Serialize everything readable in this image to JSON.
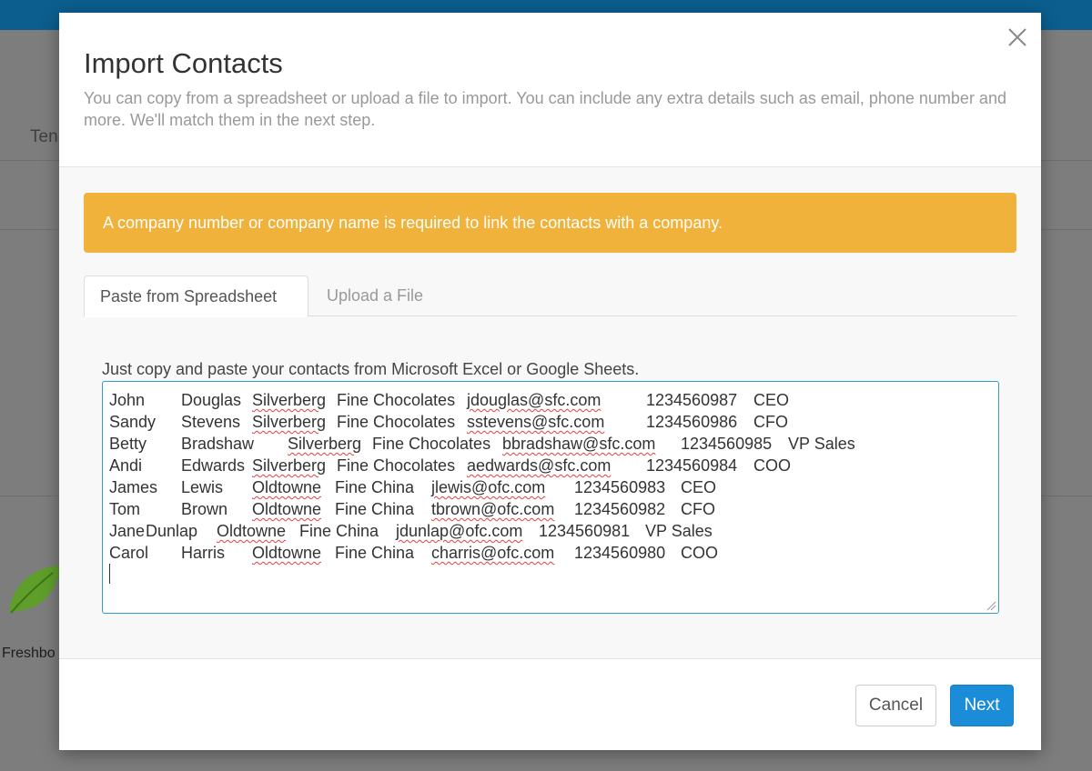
{
  "background": {
    "tab_partial": "Ten",
    "brand_partial": "Freshbo"
  },
  "modal": {
    "title": "Import Contacts",
    "subtitle": "You can copy from a spreadsheet or upload a file to import. You can include any extra details such as email, phone number and more. We'll match them in the next step.",
    "close_icon": "close-icon",
    "alert": "A company number or company name is required to link the contacts with a company.",
    "tabs": [
      {
        "label": "Paste from Spreadsheet",
        "active": true
      },
      {
        "label": "Upload a File",
        "active": false
      }
    ],
    "instructions": "Just copy and paste your contacts from Microsoft Excel or Google Sheets.",
    "rows": [
      {
        "first": "John",
        "last": "Douglas",
        "company_a": "Silverberg",
        "company_b": "Fine Chocolates",
        "email": "jdouglas@sfc.com",
        "phone": "1234560987",
        "title": "CEO"
      },
      {
        "first": "Sandy",
        "last": "Stevens",
        "company_a": "Silverberg",
        "company_b": "Fine Chocolates",
        "email": "sstevens@sfc.com",
        "phone": "1234560986",
        "title": "CFO"
      },
      {
        "first": "Betty",
        "last": "Bradshaw",
        "company_a": "Silverberg",
        "company_b": "Fine Chocolates",
        "email": "bbradshaw@sfc.com",
        "phone": "1234560985",
        "title": "VP Sales"
      },
      {
        "first": "Andi",
        "last": "Edwards",
        "company_a": "Silverberg",
        "company_b": "Fine Chocolates",
        "email": "aedwards@sfc.com",
        "phone": "1234560984",
        "title": "COO"
      },
      {
        "first": "James",
        "last": "Lewis",
        "company_a": "Oldtowne",
        "company_b": "Fine China",
        "email": "jlewis@ofc.com",
        "phone": "1234560983",
        "title": "CEO"
      },
      {
        "first": "Tom",
        "last": "Brown",
        "company_a": "Oldtowne",
        "company_b": "Fine China",
        "email": "tbrown@ofc.com",
        "phone": "1234560982",
        "title": "CFO"
      },
      {
        "first": "Jane",
        "last": "Dunlap",
        "company_a": "Oldtowne",
        "company_b": "Fine China",
        "email": "jdunlap@ofc.com",
        "phone": "1234560981",
        "title": "VP Sales"
      },
      {
        "first": "Carol",
        "last": "Harris",
        "company_a": "Oldtowne",
        "company_b": "Fine China",
        "email": "charris@ofc.com",
        "phone": "1234560980",
        "title": "COO"
      }
    ],
    "cancel_label": "Cancel",
    "next_label": "Next"
  },
  "colors": {
    "alert": "#f0b23a",
    "primary": "#1a8cd8",
    "topbar": "#0b5e8e"
  }
}
